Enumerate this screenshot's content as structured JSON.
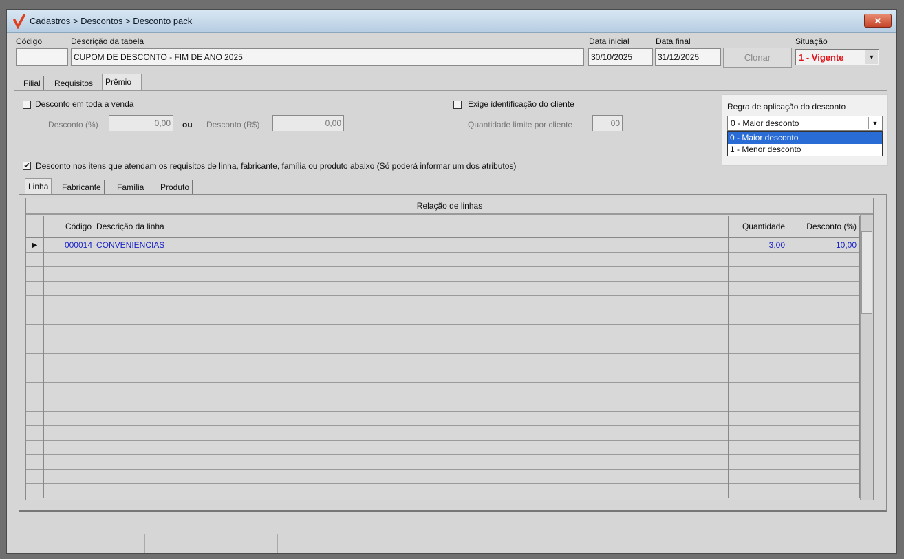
{
  "window": {
    "title": "Cadastros > Descontos > Desconto pack",
    "close_label": "✕"
  },
  "header": {
    "codigo_label": "Código",
    "codigo_value": "",
    "descricao_label": "Descrição da tabela",
    "descricao_value": "CUPOM DE DESCONTO - FIM DE ANO 2025",
    "data_inicial_label": "Data inicial",
    "data_inicial_value": "30/10/2025",
    "data_final_label": "Data final",
    "data_final_value": "31/12/2025",
    "clonar_label": "Clonar",
    "situacao_label": "Situação",
    "situacao_value": "1 - Vigente"
  },
  "tabs": [
    "Filial",
    "Requisitos",
    "Prêmio"
  ],
  "premio": {
    "desconto_toda_venda_label": "Desconto em toda a venda",
    "desconto_pct_label": "Desconto (%)",
    "desconto_pct_value": "0,00",
    "ou_label": "ou",
    "desconto_rs_label": "Desconto (R$)",
    "desconto_rs_value": "0,00",
    "exige_id_label": "Exige identificação do cliente",
    "qtd_limite_label": "Quantidade limite por cliente",
    "qtd_limite_value": "00",
    "desconto_itens_label": "Desconto nos itens que atendam os requisitos de linha, fabricante, família ou produto abaixo (Só poderá informar um dos atributos)",
    "desconto_itens_checked": "✔"
  },
  "regra": {
    "label": "Regra de aplicação do desconto",
    "selected": "0 - Maior desconto",
    "options": [
      "0 - Maior desconto",
      "1 - Menor desconto"
    ]
  },
  "subtabs": [
    "Linha",
    "Fabricante",
    "Família",
    "Produto"
  ],
  "grid": {
    "title": "Relação de linhas",
    "columns": [
      "Código",
      "Descrição da linha",
      "Quantidade",
      "Desconto (%)"
    ],
    "rows": [
      {
        "indicator": "▶",
        "codigo": "000014",
        "descricao": "CONVENIENCIAS",
        "quantidade": "3,00",
        "desconto": "10,00"
      }
    ]
  }
}
